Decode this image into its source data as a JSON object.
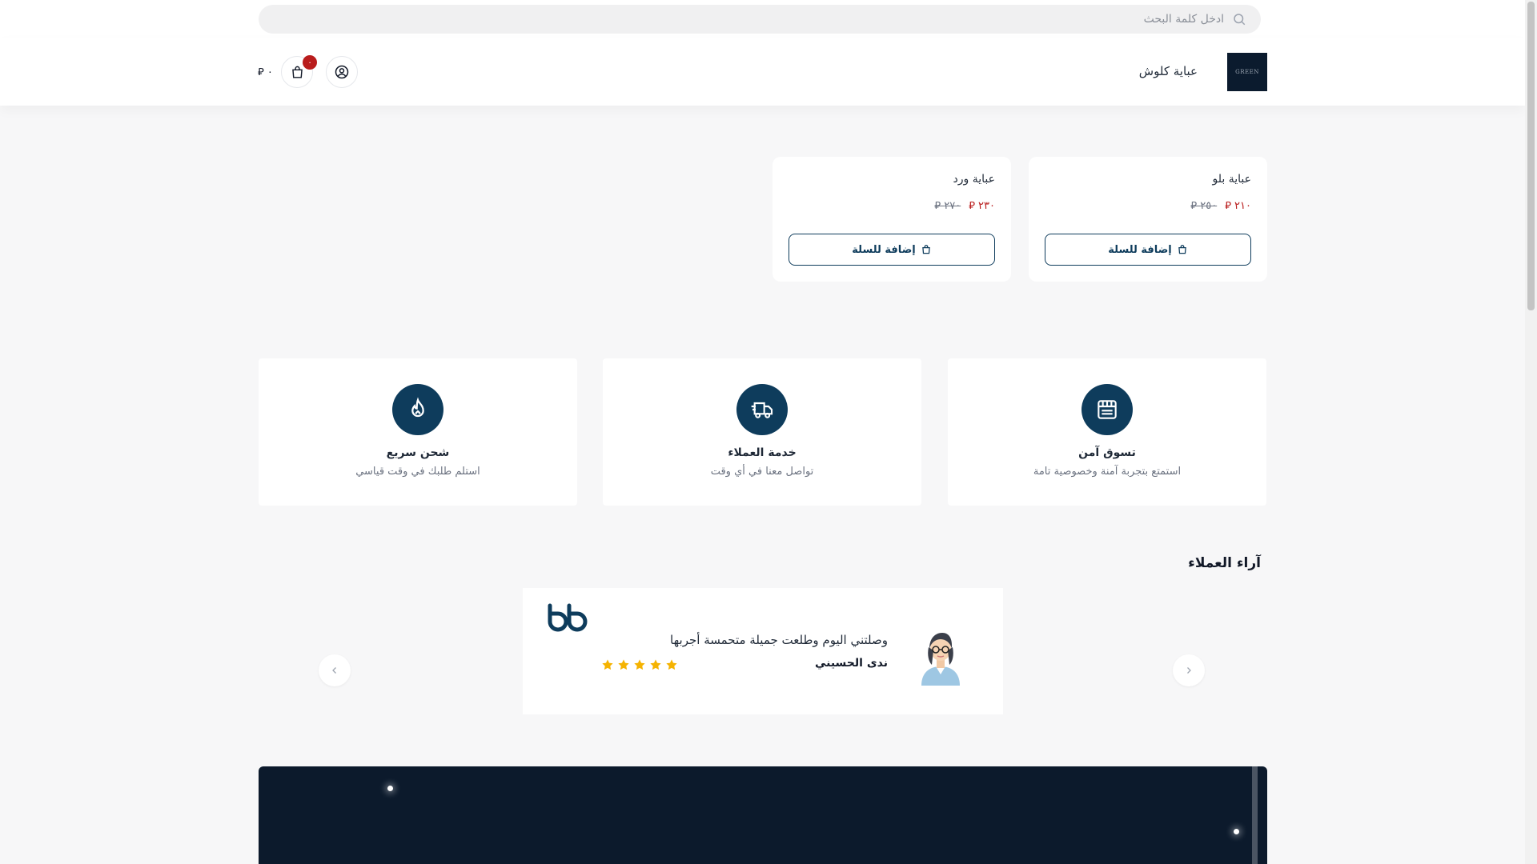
{
  "search": {
    "placeholder": "ادخل كلمة البحث"
  },
  "header": {
    "logo_text": "GREEN",
    "store_name": "عباية كلوش",
    "cart_count": "٠",
    "cart_total": "٠ ⃁"
  },
  "products": [
    {
      "name": "عباية بلو",
      "price": "٢١٠ ⃁",
      "old_price": "٢٥٠ ⃁",
      "add_label": "إضافة للسلة"
    },
    {
      "name": "عباية ورد",
      "price": "٢٣٠ ⃁",
      "old_price": "٢٧٠ ⃁",
      "add_label": "إضافة للسلة"
    }
  ],
  "features": [
    {
      "title": "تسوق آمن",
      "desc": "استمتع بتجربة آمنة وخصوصية تامة",
      "icon": "store-icon"
    },
    {
      "title": "خدمة العملاء",
      "desc": "تواصل معنا في أي وقت",
      "icon": "delivery-truck-icon"
    },
    {
      "title": "شحن سريع",
      "desc": "استلم طلبك في وقت قياسي",
      "icon": "fire-icon"
    }
  ],
  "testimonials": {
    "title": "آراء العملاء",
    "items": [
      {
        "text": "وصلتني اليوم وطلعت جميلة متحمسة أجربها",
        "name": "ندى الحسيني",
        "rating": 5
      }
    ]
  },
  "colors": {
    "primary": "#0e3c5c",
    "price": "#b91c1c",
    "star": "#f5b301",
    "banner": "#0c1a2c"
  }
}
